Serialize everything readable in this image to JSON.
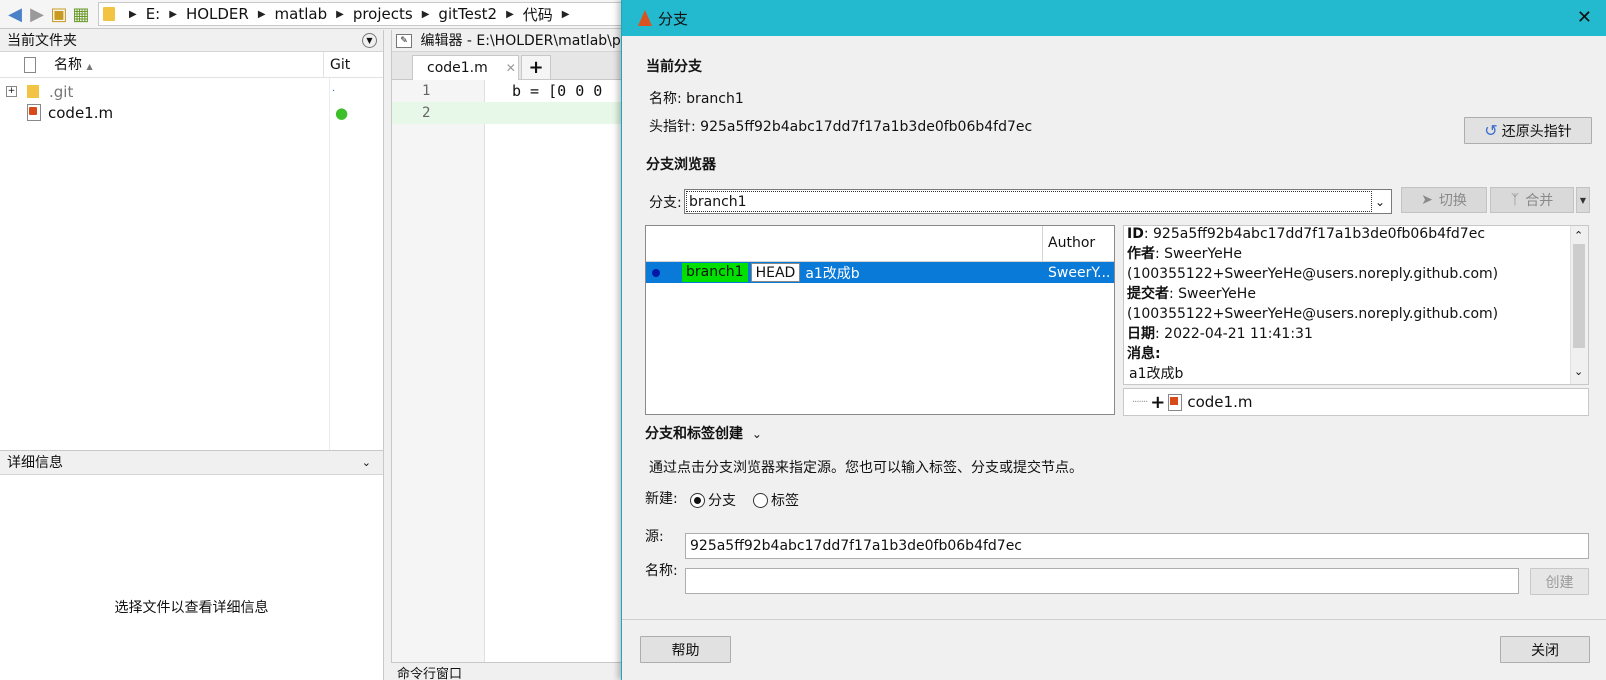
{
  "address_bar": {
    "crumbs": [
      "E:",
      "HOLDER",
      "matlab",
      "projects",
      "gitTest2",
      "代码"
    ]
  },
  "current_folder": {
    "title": "当前文件夹",
    "col_name": "名称",
    "col_git": "Git",
    "files": [
      {
        "name": ".git",
        "git_status": "·"
      },
      {
        "name": "code1.m",
        "git_status": "●"
      }
    ]
  },
  "details": {
    "title": "详细信息",
    "placeholder": "选择文件以查看详细信息"
  },
  "editor": {
    "title": "编辑器 - E:\\HOLDER\\matlab\\p",
    "tab_label": "code1.m",
    "tab_close": "✕",
    "tab_add": "+",
    "lines": [
      {
        "num": "1",
        "code": "b = [0 0 0"
      },
      {
        "num": "2",
        "code": ""
      }
    ]
  },
  "command_window": {
    "title": "命令行窗口"
  },
  "dialog": {
    "title": "分支",
    "close": "✕",
    "current_branch": {
      "header": "当前分支",
      "name_label": "名称:",
      "name_value": "branch1",
      "head_label": "头指针:",
      "head_value": "925a5ff92b4abc17dd7f17a1b3de0fb06b4fd7ec",
      "revert_button": "还原头指针"
    },
    "branch_browser": {
      "header": "分支浏览器",
      "branch_label": "分支:",
      "branch_value": "branch1",
      "switch_button": "切换",
      "merge_button": "合并",
      "author_col": "Author",
      "commits": [
        {
          "branch_tag": "branch1",
          "head_tag": "HEAD",
          "message": "a1改成b",
          "author": "SweerY..."
        }
      ],
      "info": {
        "id_label": "ID",
        "id_value": "925a5ff92b4abc17dd7f17a1b3de0fb06b4fd7ec",
        "author_label": "作者",
        "author_value": "SweerYeHe (100355122+SweerYeHe@users.noreply.github.com)",
        "committer_label": "提交者",
        "committer_value": "SweerYeHe (100355122+SweerYeHe@users.noreply.github.com)",
        "date_label": "日期",
        "date_value": "2022-04-21 11:41:31",
        "message_label": "消息:",
        "message_value": "a1改成b"
      },
      "changed_file": "code1.m"
    },
    "create": {
      "header": "分支和标签创建",
      "description": "通过点击分支浏览器来指定源。您也可以输入标签、分支或提交节点。",
      "new_label": "新建:",
      "radio_branch": "分支",
      "radio_tag": "标签",
      "source_label": "源:",
      "source_value": "925a5ff92b4abc17dd7f17a1b3de0fb06b4fd7ec",
      "name_label": "名称:",
      "name_value": "",
      "create_button": "创建"
    },
    "help_button": "帮助",
    "close_button": "关闭"
  }
}
